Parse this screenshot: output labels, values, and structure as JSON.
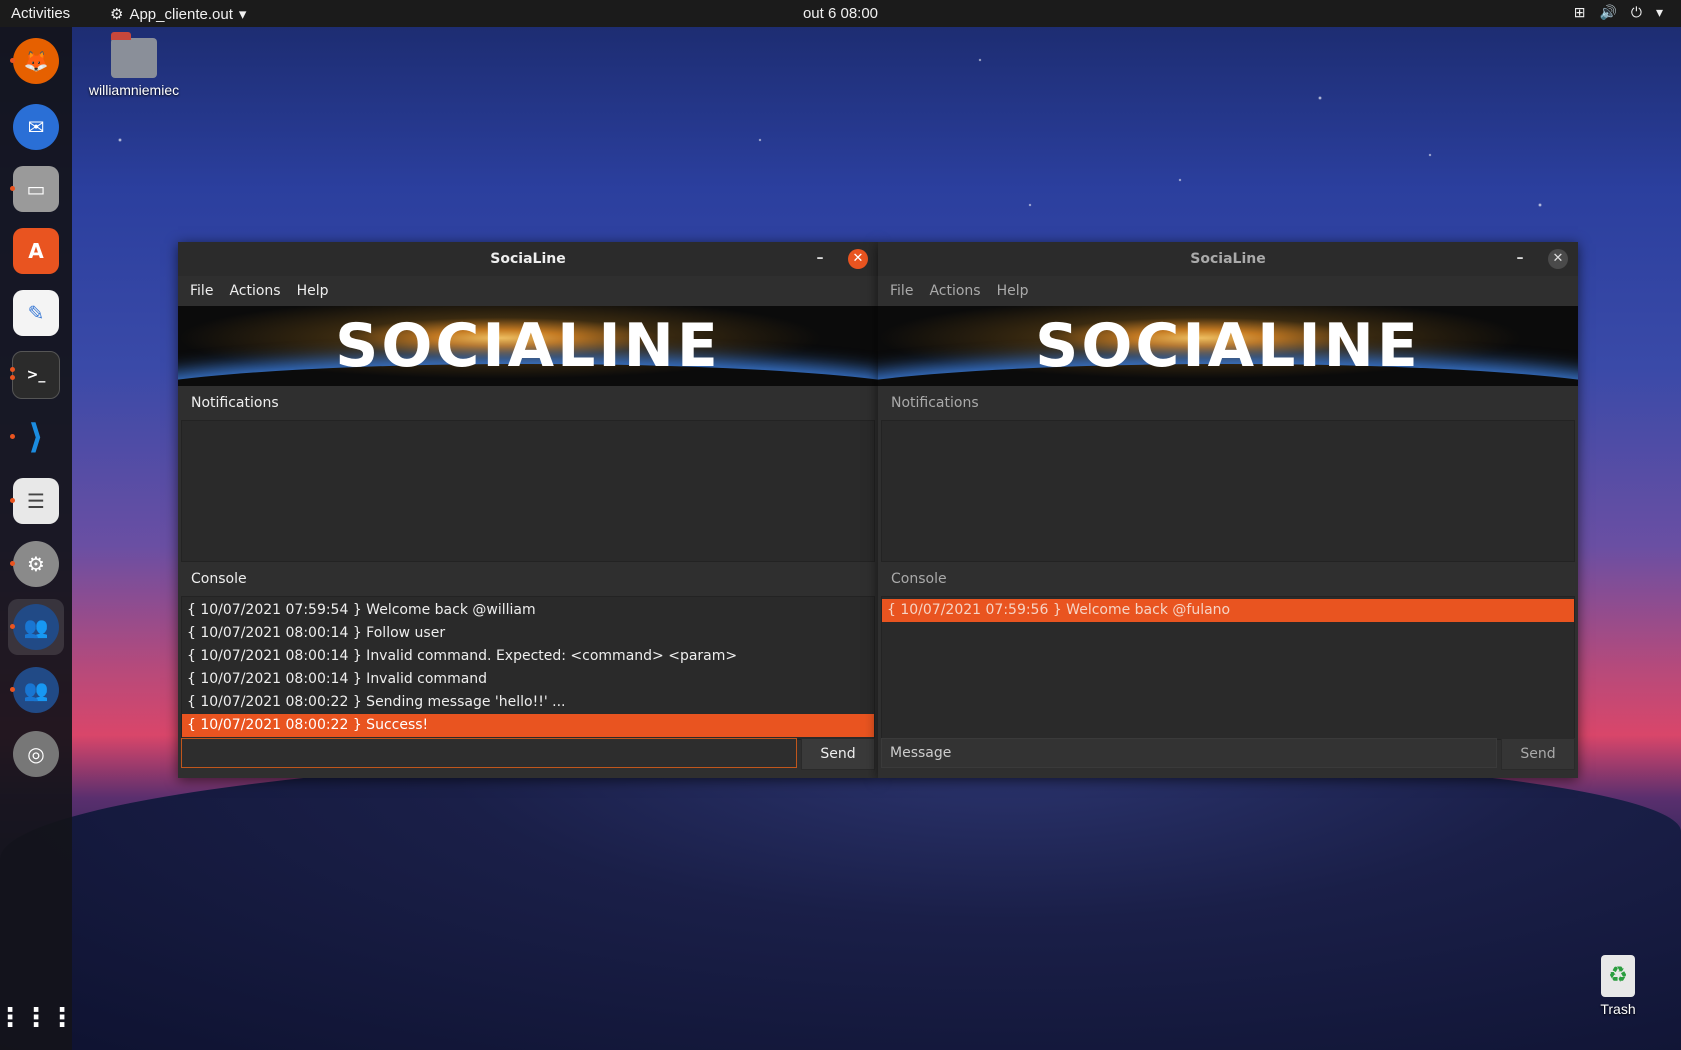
{
  "topbar": {
    "activities": "Activities",
    "app_name": "App_cliente.out",
    "clock": "out 6  08:00"
  },
  "desktop": {
    "home_label": "williamniemiec",
    "trash_label": "Trash"
  },
  "dock": {
    "items": [
      {
        "name": "firefox",
        "icon": "firefox-icon",
        "color": "#e66000"
      },
      {
        "name": "thunderbird",
        "icon": "thunderbird-icon",
        "color": "#2a6fd6"
      },
      {
        "name": "files",
        "icon": "files-icon",
        "color": "#9a9a9a"
      },
      {
        "name": "software",
        "icon": "software-icon",
        "color": "#e95420"
      },
      {
        "name": "text-editor",
        "icon": "text-editor-icon",
        "color": "#3c7bd6"
      },
      {
        "name": "terminal",
        "icon": "terminal-icon",
        "color": "#2b2b2b"
      },
      {
        "name": "vscode",
        "icon": "vscode-icon",
        "color": "#0e6fc2"
      },
      {
        "name": "document-viewer",
        "icon": "document-viewer-icon",
        "color": "#cfcfcf"
      },
      {
        "name": "settings",
        "icon": "settings-icon",
        "color": "#8a8a8a"
      },
      {
        "name": "socialine-1",
        "icon": "people-icon",
        "color": "#214a86"
      },
      {
        "name": "socialine-2",
        "icon": "people-icon",
        "color": "#214a86"
      },
      {
        "name": "disc",
        "icon": "disc-icon",
        "color": "#777"
      }
    ]
  },
  "window_left": {
    "title": "SociaLine",
    "menu": [
      "File",
      "Actions",
      "Help"
    ],
    "banner_text": "SOCIALINE",
    "notifications_label": "Notifications",
    "console_label": "Console",
    "console_rows": [
      "{ 10/07/2021 07:59:54 } Welcome back @william",
      "{ 10/07/2021 08:00:14 } Follow user",
      "{ 10/07/2021 08:00:14 } Invalid command. Expected: <command> <param>",
      "{ 10/07/2021 08:00:14 } Invalid command",
      "{ 10/07/2021 08:00:22 } Sending message 'hello!!' ...",
      "{ 10/07/2021 08:00:22 } Success!"
    ],
    "input_value": "",
    "input_placeholder": "",
    "send_label": "Send"
  },
  "window_right": {
    "title": "SociaLine",
    "menu": [
      "File",
      "Actions",
      "Help"
    ],
    "banner_text": "SOCIALINE",
    "notifications_label": "Notifications",
    "console_label": "Console",
    "console_rows": [
      "{ 10/07/2021 07:59:56 } Welcome back @fulano"
    ],
    "input_placeholder": "Message",
    "send_label": "Send"
  },
  "colors": {
    "accent": "#e95420"
  }
}
